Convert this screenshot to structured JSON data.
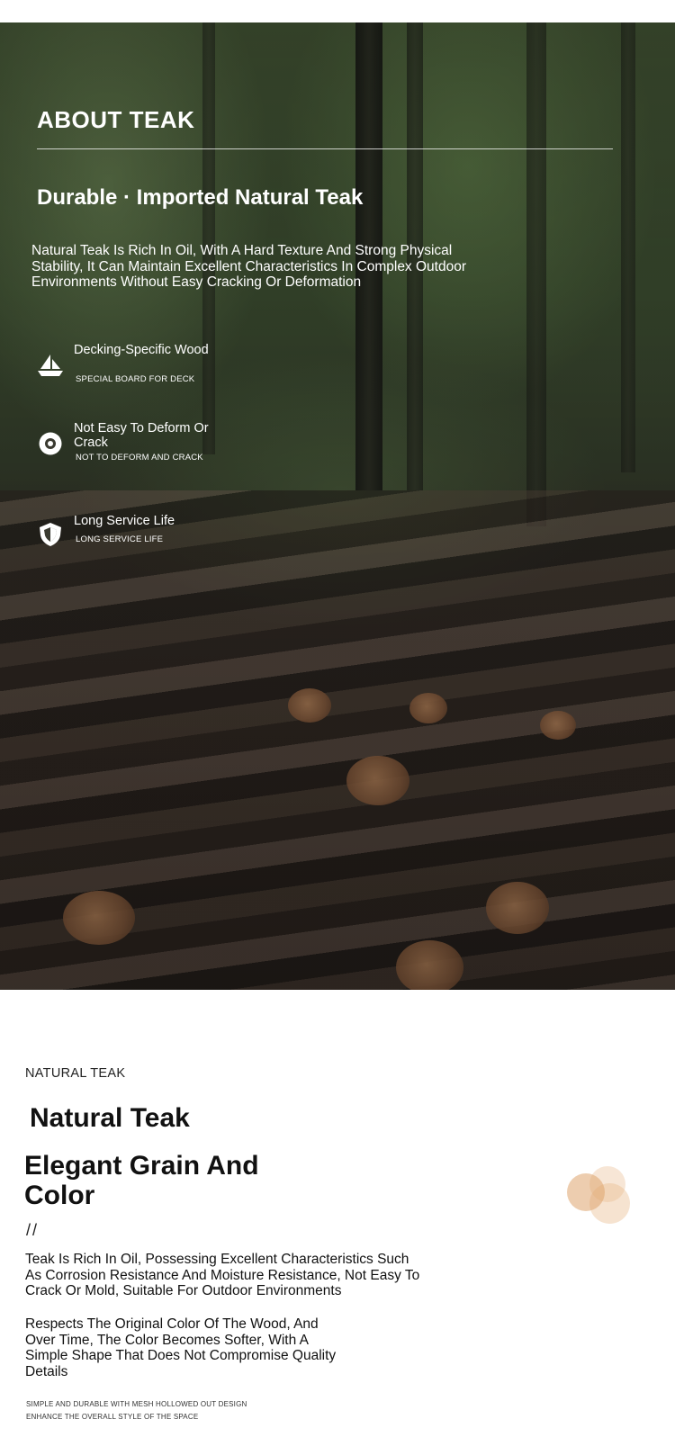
{
  "about": {
    "title": "ABOUT TEAK",
    "subtitle": "Durable · Imported Natural Teak",
    "description": "Natural Teak Is Rich In Oil, With A Hard Texture And Strong Physical Stability, It Can Maintain Excellent Characteristics In Complex Outdoor Environments Without Easy Cracking Or Deformation",
    "features": [
      {
        "icon": "boat-icon",
        "name": "Decking-Specific Wood",
        "sub": "SPECIAL BOARD FOR DECK"
      },
      {
        "icon": "target-icon",
        "name": "Not Easy To Deform Or Crack",
        "sub": "NOT TO DEFORM AND CRACK"
      },
      {
        "icon": "shield-icon",
        "name": "Long Service Life",
        "sub": "LONG SERVICE LIFE"
      }
    ]
  },
  "natural": {
    "label": "NATURAL TEAK",
    "title": "Natural Teak",
    "heading": "Elegant Grain And Color",
    "divider": "//",
    "description": "Teak Is Rich In Oil, Possessing Excellent Characteristics Such As Corrosion Resistance And Moisture Resistance, Not Easy To Crack Or Mold, Suitable For Outdoor Environments",
    "description2": "Respects The Original Color Of The Wood, And Over Time, The Color Becomes Softer, With A Simple Shape That Does Not Compromise Quality Details",
    "footer_lines": [
      "SIMPLE AND DURABLE WITH MESH HOLLOWED OUT DESIGN",
      "ENHANCE THE OVERALL STYLE OF THE SPACE"
    ]
  },
  "colors": {
    "text_dark": "#111111",
    "accent_circle": "#e8b88a"
  }
}
